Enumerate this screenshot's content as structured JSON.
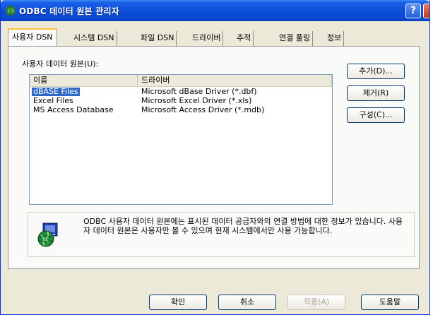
{
  "window": {
    "title": "ODBC 데이터 원본 관리자",
    "help_label": "?"
  },
  "tabs": [
    {
      "label": "사용자 DSN",
      "active": true
    },
    {
      "label": "시스템 DSN"
    },
    {
      "label": "파일 DSN"
    },
    {
      "label": "드라이버"
    },
    {
      "label": "추적"
    },
    {
      "label": "연결 풀링"
    },
    {
      "label": "정보"
    }
  ],
  "list_label": "사용자 데이터 원본(U):",
  "columns": [
    "이름",
    "드라이버"
  ],
  "rows": [
    {
      "name": "dBASE Files",
      "driver": "Microsoft dBase Driver (*.dbf)",
      "selected": true
    },
    {
      "name": "Excel Files",
      "driver": "Microsoft Excel Driver (*.xls)"
    },
    {
      "name": "MS Access Database",
      "driver": "Microsoft Access Driver (*.mdb)"
    }
  ],
  "side_buttons": {
    "add": "추가(D)...",
    "remove": "제거(R)",
    "configure": "구성(C)..."
  },
  "info_text": "ODBC 사용자 데이터 원본에는 표시된 데이터 공급자와의 연결 방법에 대한 정보가 있습니다. 사용자 데이터 원본은 사용자만 볼 수 있으며 현재 시스템에서만 사용 가능합니다.",
  "footer_buttons": {
    "ok": "확인",
    "cancel": "취소",
    "apply": "적용(A)",
    "help": "도움말"
  },
  "colors": {
    "title_bar": "#0a48d0",
    "selection": "#316ac5",
    "tab_highlight": "#ffc83c"
  }
}
